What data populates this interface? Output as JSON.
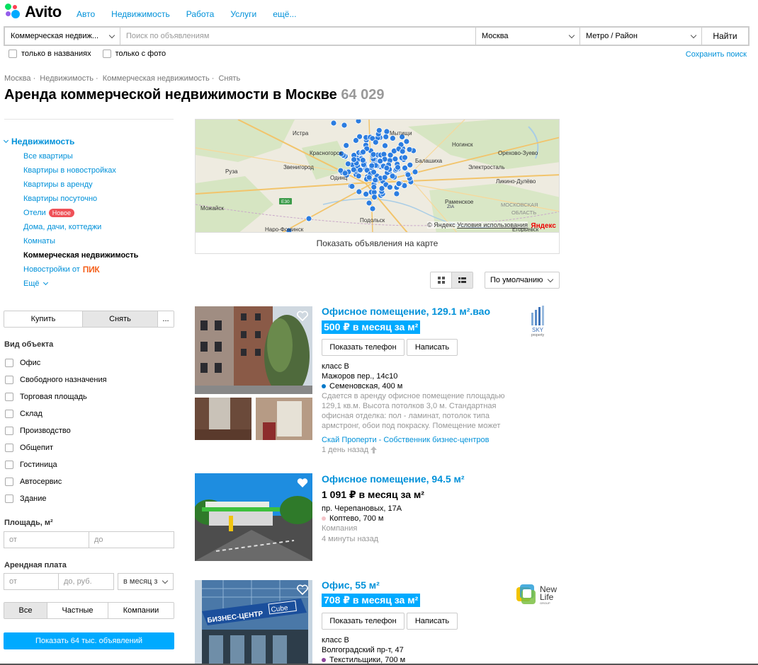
{
  "header": {
    "logo_text": "Avito",
    "nav": [
      "Авто",
      "Недвижимость",
      "Работа",
      "Услуги",
      "ещё..."
    ]
  },
  "search": {
    "category": "Коммерческая недвиж...",
    "placeholder": "Поиск по объявлениям",
    "city": "Москва",
    "metro": "Метро / Район",
    "submit": "Найти",
    "only_titles": "только в названиях",
    "only_photo": "только с фото",
    "save": "Сохранить поиск"
  },
  "breadcrumbs": [
    "Москва",
    "Недвижимость",
    "Коммерческая недвижимость",
    "Снять"
  ],
  "page": {
    "title": "Аренда коммерческой недвижимости в Москве",
    "count": "64 029"
  },
  "sidebar": {
    "root": "Недвижимость",
    "items": [
      {
        "label": "Все квартиры"
      },
      {
        "label": "Квартиры в новостройках"
      },
      {
        "label": "Квартиры в аренду"
      },
      {
        "label": "Квартиры посуточно"
      },
      {
        "label": "Отели",
        "badge": "Новое"
      },
      {
        "label": "Дома, дачи, коттеджи"
      },
      {
        "label": "Комнаты"
      },
      {
        "label": "Коммерческая недвижимость"
      },
      {
        "label": "Новостройки от",
        "brand": "ПИК"
      },
      {
        "label": "Ещё"
      }
    ],
    "deal": [
      "Купить",
      "Снять",
      "..."
    ],
    "type_title": "Вид объекта",
    "types": [
      "Офис",
      "Свободного назначения",
      "Торговая площадь",
      "Склад",
      "Производство",
      "Общепит",
      "Гостиница",
      "Автосервис",
      "Здание"
    ],
    "area_title": "Площадь, м²",
    "area_from": "от",
    "area_to": "до",
    "rent_title": "Арендная плата",
    "rent_from": "от",
    "rent_to": "до, руб.",
    "rent_period": "в месяц з",
    "owner": [
      "Все",
      "Частные",
      "Компании"
    ],
    "show_button": "Показать 64 тыс. объявлений"
  },
  "map": {
    "places": [
      "Истра",
      "Мытищи",
      "Ногинск",
      "Красногорск",
      "Балашиха",
      "Орехово-Зуево",
      "Звенигород",
      "Одинц",
      "Электросталь",
      "Руза",
      "Ликино-Дулёво",
      "Можайск",
      "Раменское",
      "МОСКОВСКАЯ",
      "ОБЛАСТЬ",
      "Подольск",
      "Наро-Фоминск",
      "Егорьевск",
      "E30",
      "ZIA"
    ],
    "copyright": "© Яндекс",
    "terms": "Условия использования",
    "brand": "Яндекс",
    "button": "Показать объявления на карте"
  },
  "sort": {
    "selected": "По умолчанию"
  },
  "listings": [
    {
      "title": "Офисное помещение, 129.1 м².вао",
      "price": "500 ₽ в месяц за м²",
      "highlight": true,
      "show_phone": "Показать телефон",
      "write": "Написать",
      "class": "класс B",
      "address": "Мажоров пер., 14с10",
      "metro": "Семеновская, 400 м",
      "metro_color": "#0078c9",
      "description": [
        "Сдается в аренду офисное помещение площадью",
        "129,1 кв.м. Высота потолков 3,0 м. Стандартная",
        "офисная отделка: пол - ламинат, потолок типа",
        "армстронг, обои под покраску. Помещение может"
      ],
      "seller": "Скай Проперти - Собственник бизнес-центров",
      "time": "1 день назад",
      "logo": {
        "name": "SKY",
        "sub": "property"
      }
    },
    {
      "title": "Офисное помещение, 94.5 м²",
      "price": "1 091 ₽ в месяц за м²",
      "highlight": false,
      "address": "пр. Черепановых, 17А",
      "metro": "Коптево, 700 м",
      "metro_color": "#f4c3c8",
      "seller_type": "Компания",
      "time": "4 минуты назад"
    },
    {
      "title": "Офис, 55 м²",
      "price": "708 ₽ в месяц за м²",
      "highlight": true,
      "show_phone": "Показать телефон",
      "write": "Написать",
      "class": "класс B",
      "address": "Волгоградский пр-т, 47",
      "metro": "Текстильщики, 700 м",
      "metro_color": "#8e479c",
      "sign_text": "БИЗНЕС-ЦЕНТР",
      "sign_brand": "Cube",
      "logo": {
        "name": "New",
        "name2": "Life",
        "sub": "GROUP"
      }
    }
  ]
}
